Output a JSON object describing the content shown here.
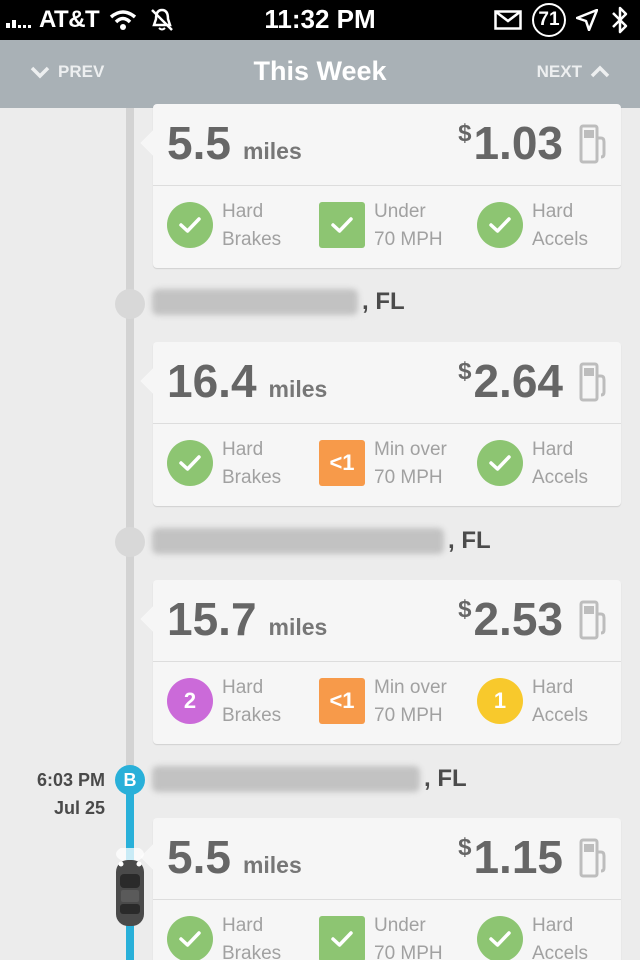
{
  "colors": {
    "green": "#8dc572",
    "orange": "#f79a4a",
    "purple": "#cb6ad9",
    "yellow": "#f8c92c",
    "accent_blue": "#29b0d9",
    "nav_gray": "#a9b1b6"
  },
  "status_bar": {
    "carrier": "AT&T",
    "time": "11:32 PM",
    "badge": "71",
    "icons": [
      "signal-icon",
      "wifi-icon",
      "bell-muted-icon",
      "mail-icon",
      "location-icon",
      "bluetooth-icon"
    ]
  },
  "nav": {
    "prev_label": "PREV",
    "next_label": "NEXT",
    "title": "This Week"
  },
  "timeline": {
    "locations": [
      {
        "suffix": ", FL"
      },
      {
        "suffix": ", FL"
      },
      {
        "suffix": ", FL",
        "marker": "B",
        "time": "6:03 PM",
        "date": "Jul 25"
      }
    ]
  },
  "trips": [
    {
      "miles": "5.5",
      "unit": "miles",
      "currency": "$",
      "cost": "1.03",
      "stats": [
        {
          "badge": "",
          "icon": "check-icon",
          "shape": "circle",
          "color": "green",
          "label": "Hard\nBrakes"
        },
        {
          "badge": "",
          "icon": "check-icon",
          "shape": "square",
          "color": "green",
          "label": "Under\n70 MPH"
        },
        {
          "badge": "",
          "icon": "check-icon",
          "shape": "circle",
          "color": "green",
          "label": "Hard\nAccels"
        }
      ]
    },
    {
      "miles": "16.4",
      "unit": "miles",
      "currency": "$",
      "cost": "2.64",
      "stats": [
        {
          "badge": "",
          "icon": "check-icon",
          "shape": "circle",
          "color": "green",
          "label": "Hard\nBrakes"
        },
        {
          "badge": "<1",
          "icon": "",
          "shape": "square",
          "color": "orange",
          "label": "Min over\n70 MPH"
        },
        {
          "badge": "",
          "icon": "check-icon",
          "shape": "circle",
          "color": "green",
          "label": "Hard\nAccels"
        }
      ]
    },
    {
      "miles": "15.7",
      "unit": "miles",
      "currency": "$",
      "cost": "2.53",
      "stats": [
        {
          "badge": "2",
          "icon": "",
          "shape": "circle",
          "color": "purple",
          "label": "Hard\nBrakes"
        },
        {
          "badge": "<1",
          "icon": "",
          "shape": "square",
          "color": "orange",
          "label": "Min over\n70 MPH"
        },
        {
          "badge": "1",
          "icon": "",
          "shape": "circle",
          "color": "yellow",
          "label": "Hard\nAccels"
        }
      ]
    },
    {
      "miles": "5.5",
      "unit": "miles",
      "currency": "$",
      "cost": "1.15",
      "stats": [
        {
          "badge": "",
          "icon": "check-icon",
          "shape": "circle",
          "color": "green",
          "label": "Hard\nBrakes"
        },
        {
          "badge": "",
          "icon": "check-icon",
          "shape": "square",
          "color": "green",
          "label": "Under\n70 MPH"
        },
        {
          "badge": "",
          "icon": "check-icon",
          "shape": "circle",
          "color": "green",
          "label": "Hard\nAccels"
        }
      ]
    }
  ]
}
